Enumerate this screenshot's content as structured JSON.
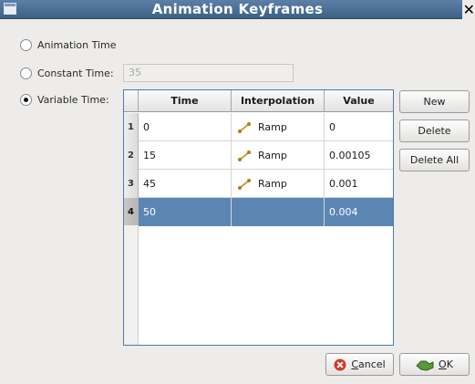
{
  "window": {
    "title": "Animation Keyframes"
  },
  "radios": [
    {
      "label": "Animation Time",
      "checked": false
    },
    {
      "label": "Constant Time:",
      "checked": false
    },
    {
      "label": "Variable Time:",
      "checked": true
    }
  ],
  "constant_time": {
    "value": "35"
  },
  "table": {
    "columns": [
      "Time",
      "Interpolation",
      "Value"
    ],
    "rows": [
      {
        "num": "1",
        "time": "0",
        "interpolation": "Ramp",
        "value": "0"
      },
      {
        "num": "2",
        "time": "15",
        "interpolation": "Ramp",
        "value": "0.00105"
      },
      {
        "num": "3",
        "time": "45",
        "interpolation": "Ramp",
        "value": "0.001"
      },
      {
        "num": "4",
        "time": "50",
        "interpolation": "",
        "value": "0.004",
        "selected": true
      }
    ]
  },
  "buttons": {
    "new": "New",
    "delete": "Delete",
    "delete_all": "Delete All",
    "cancel_mnemonic": "C",
    "cancel_rest": "ancel",
    "ok_mnemonic": "O",
    "ok_rest": "K"
  },
  "icons": {
    "window": "window-menu-icon",
    "close": "close-icon",
    "ramp": "ramp-icon",
    "cancel": "cancel-icon",
    "ok": "ok-icon"
  },
  "colors": {
    "titlebar": "#46698f",
    "selection": "#5b86b4",
    "table_border": "#4f7aa4",
    "cancel_icon": "#d23a2a",
    "ok_icon": "#5a9a3a"
  }
}
